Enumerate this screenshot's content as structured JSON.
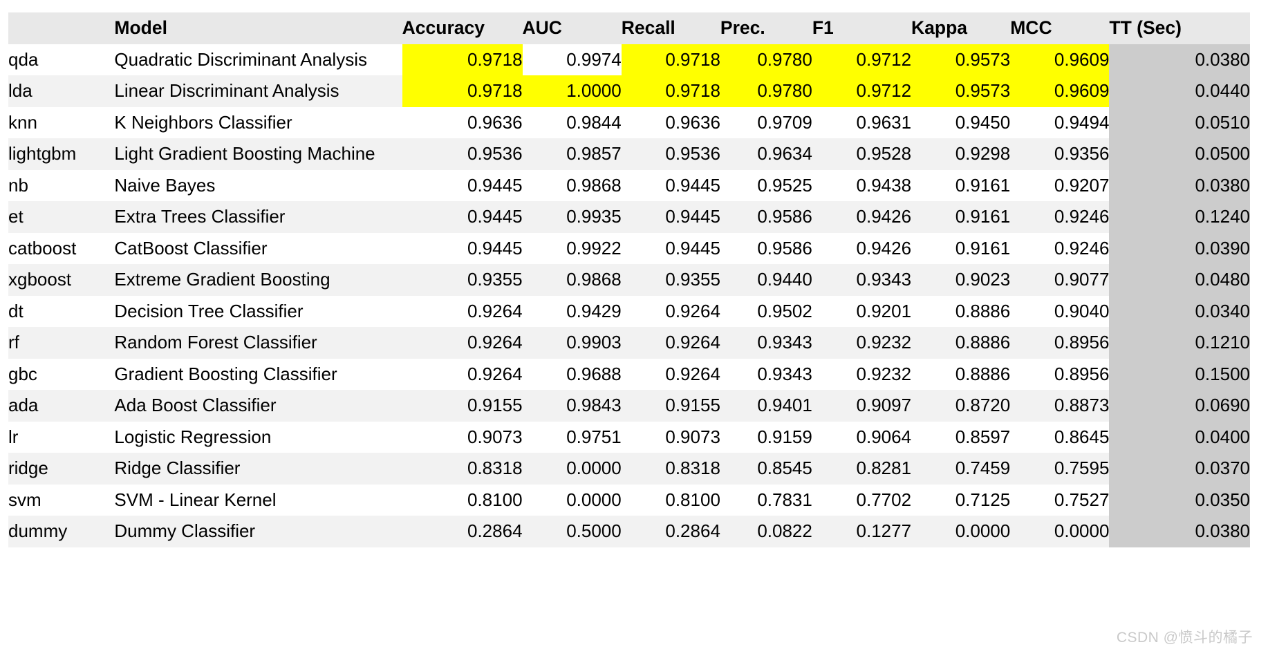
{
  "table": {
    "columns": [
      {
        "key": "index",
        "label": "",
        "align": "left"
      },
      {
        "key": "model",
        "label": "Model",
        "align": "left"
      },
      {
        "key": "accuracy",
        "label": "Accuracy",
        "align": "right"
      },
      {
        "key": "auc",
        "label": "AUC",
        "align": "right"
      },
      {
        "key": "recall",
        "label": "Recall",
        "align": "right"
      },
      {
        "key": "prec",
        "label": "Prec.",
        "align": "right"
      },
      {
        "key": "f1",
        "label": "F1",
        "align": "right"
      },
      {
        "key": "kappa",
        "label": "Kappa",
        "align": "right"
      },
      {
        "key": "mcc",
        "label": "MCC",
        "align": "right"
      },
      {
        "key": "tt",
        "label": "TT (Sec)",
        "align": "right"
      }
    ],
    "rows": [
      {
        "index": "qda",
        "model": "Quadratic Discriminant Analysis",
        "accuracy": "0.9718",
        "auc": "0.9974",
        "recall": "0.9718",
        "prec": "0.9780",
        "f1": "0.9712",
        "kappa": "0.9573",
        "mcc": "0.9609",
        "tt": "0.0380",
        "highlight": {
          "accuracy": "yellow",
          "auc": "white",
          "recall": "yellow",
          "prec": "yellow",
          "f1": "yellow",
          "kappa": "yellow",
          "mcc": "yellow"
        }
      },
      {
        "index": "lda",
        "model": "Linear Discriminant Analysis",
        "accuracy": "0.9718",
        "auc": "1.0000",
        "recall": "0.9718",
        "prec": "0.9780",
        "f1": "0.9712",
        "kappa": "0.9573",
        "mcc": "0.9609",
        "tt": "0.0440",
        "highlight": {
          "accuracy": "yellow",
          "auc": "yellow",
          "recall": "yellow",
          "prec": "yellow",
          "f1": "yellow",
          "kappa": "yellow",
          "mcc": "yellow"
        }
      },
      {
        "index": "knn",
        "model": "K Neighbors Classifier",
        "accuracy": "0.9636",
        "auc": "0.9844",
        "recall": "0.9636",
        "prec": "0.9709",
        "f1": "0.9631",
        "kappa": "0.9450",
        "mcc": "0.9494",
        "tt": "0.0510",
        "highlight": {}
      },
      {
        "index": "lightgbm",
        "model": "Light Gradient Boosting Machine",
        "accuracy": "0.9536",
        "auc": "0.9857",
        "recall": "0.9536",
        "prec": "0.9634",
        "f1": "0.9528",
        "kappa": "0.9298",
        "mcc": "0.9356",
        "tt": "0.0500",
        "highlight": {}
      },
      {
        "index": "nb",
        "model": "Naive Bayes",
        "accuracy": "0.9445",
        "auc": "0.9868",
        "recall": "0.9445",
        "prec": "0.9525",
        "f1": "0.9438",
        "kappa": "0.9161",
        "mcc": "0.9207",
        "tt": "0.0380",
        "highlight": {}
      },
      {
        "index": "et",
        "model": "Extra Trees Classifier",
        "accuracy": "0.9445",
        "auc": "0.9935",
        "recall": "0.9445",
        "prec": "0.9586",
        "f1": "0.9426",
        "kappa": "0.9161",
        "mcc": "0.9246",
        "tt": "0.1240",
        "highlight": {}
      },
      {
        "index": "catboost",
        "model": "CatBoost Classifier",
        "accuracy": "0.9445",
        "auc": "0.9922",
        "recall": "0.9445",
        "prec": "0.9586",
        "f1": "0.9426",
        "kappa": "0.9161",
        "mcc": "0.9246",
        "tt": "0.0390",
        "highlight": {}
      },
      {
        "index": "xgboost",
        "model": "Extreme Gradient Boosting",
        "accuracy": "0.9355",
        "auc": "0.9868",
        "recall": "0.9355",
        "prec": "0.9440",
        "f1": "0.9343",
        "kappa": "0.9023",
        "mcc": "0.9077",
        "tt": "0.0480",
        "highlight": {}
      },
      {
        "index": "dt",
        "model": "Decision Tree Classifier",
        "accuracy": "0.9264",
        "auc": "0.9429",
        "recall": "0.9264",
        "prec": "0.9502",
        "f1": "0.9201",
        "kappa": "0.8886",
        "mcc": "0.9040",
        "tt": "0.0340",
        "highlight": {}
      },
      {
        "index": "rf",
        "model": "Random Forest Classifier",
        "accuracy": "0.9264",
        "auc": "0.9903",
        "recall": "0.9264",
        "prec": "0.9343",
        "f1": "0.9232",
        "kappa": "0.8886",
        "mcc": "0.8956",
        "tt": "0.1210",
        "highlight": {}
      },
      {
        "index": "gbc",
        "model": "Gradient Boosting Classifier",
        "accuracy": "0.9264",
        "auc": "0.9688",
        "recall": "0.9264",
        "prec": "0.9343",
        "f1": "0.9232",
        "kappa": "0.8886",
        "mcc": "0.8956",
        "tt": "0.1500",
        "highlight": {}
      },
      {
        "index": "ada",
        "model": "Ada Boost Classifier",
        "accuracy": "0.9155",
        "auc": "0.9843",
        "recall": "0.9155",
        "prec": "0.9401",
        "f1": "0.9097",
        "kappa": "0.8720",
        "mcc": "0.8873",
        "tt": "0.0690",
        "highlight": {}
      },
      {
        "index": "lr",
        "model": "Logistic Regression",
        "accuracy": "0.9073",
        "auc": "0.9751",
        "recall": "0.9073",
        "prec": "0.9159",
        "f1": "0.9064",
        "kappa": "0.8597",
        "mcc": "0.8645",
        "tt": "0.0400",
        "highlight": {}
      },
      {
        "index": "ridge",
        "model": "Ridge Classifier",
        "accuracy": "0.8318",
        "auc": "0.0000",
        "recall": "0.8318",
        "prec": "0.8545",
        "f1": "0.8281",
        "kappa": "0.7459",
        "mcc": "0.7595",
        "tt": "0.0370",
        "highlight": {}
      },
      {
        "index": "svm",
        "model": "SVM - Linear Kernel",
        "accuracy": "0.8100",
        "auc": "0.0000",
        "recall": "0.8100",
        "prec": "0.7831",
        "f1": "0.7702",
        "kappa": "0.7125",
        "mcc": "0.7527",
        "tt": "0.0350",
        "highlight": {}
      },
      {
        "index": "dummy",
        "model": "Dummy Classifier",
        "accuracy": "0.2864",
        "auc": "0.5000",
        "recall": "0.2864",
        "prec": "0.0822",
        "f1": "0.1277",
        "kappa": "0.0000",
        "mcc": "0.0000",
        "tt": "0.0380",
        "highlight": {}
      }
    ]
  },
  "watermark": {
    "text": "CSDN @愤斗的橘子"
  },
  "colors": {
    "header_bg": "#e8e8e8",
    "row_odd_bg": "#ffffff",
    "row_even_bg": "#f2f2f2",
    "tt_column_bg": "#cccccc",
    "highlight_yellow": "#ffff00",
    "highlight_white": "#ffffff",
    "text": "#000000",
    "watermark": "#c9c9c9"
  }
}
